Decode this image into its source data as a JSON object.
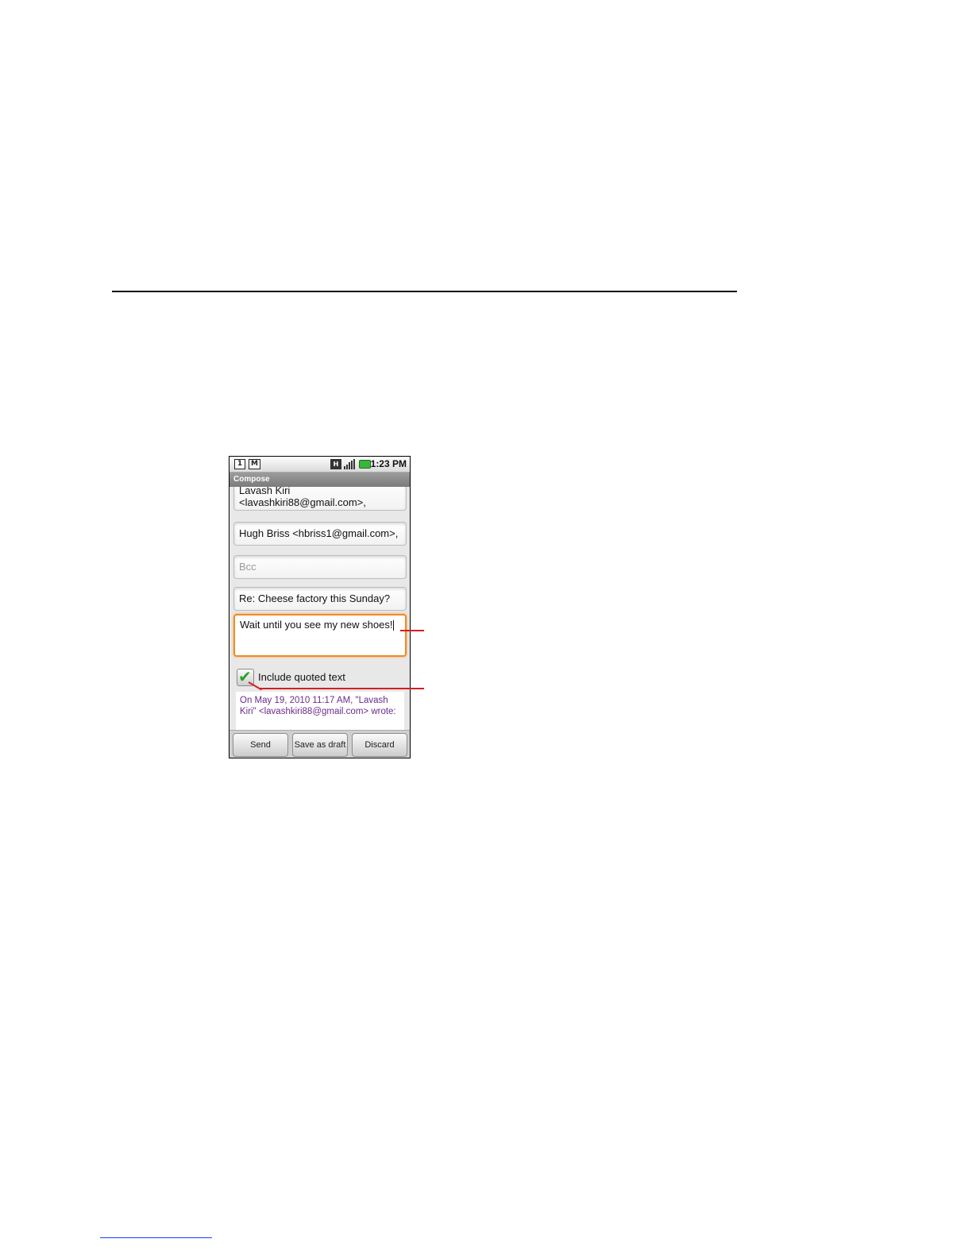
{
  "status_bar": {
    "time": "1:23 PM",
    "notif_icon_1": "1",
    "notif_icon_2": "M",
    "network_label": "H",
    "icons": [
      "calendar-notification-icon",
      "gmail-notification-icon",
      "hspa-icon",
      "signal-icon",
      "battery-icon"
    ],
    "battery_color": "#3ab53a"
  },
  "title_bar": {
    "title": "Compose"
  },
  "compose": {
    "to_value": "Lavash Kiri <lavashkiri88@gmail.com>,",
    "cc_value": "Hugh Briss <hbriss1@gmail.com>,",
    "bcc_placeholder": "Bcc",
    "subject_value": "Re: Cheese factory this Sunday?",
    "body_value": "Wait until you see my new shoes!",
    "include_quoted_label": "Include quoted text",
    "include_quoted_checked": true,
    "quoted_text": "On May 19, 2010 11:17 AM, \"Lavash Kiri\" <lavashkiri88@gmail.com> wrote:",
    "focus_color": "#f08a24",
    "quoted_color": "#6b2a8c"
  },
  "buttons": {
    "send": "Send",
    "save_draft": "Save as draft",
    "discard": "Discard"
  },
  "callout_color": "#d21f1f"
}
